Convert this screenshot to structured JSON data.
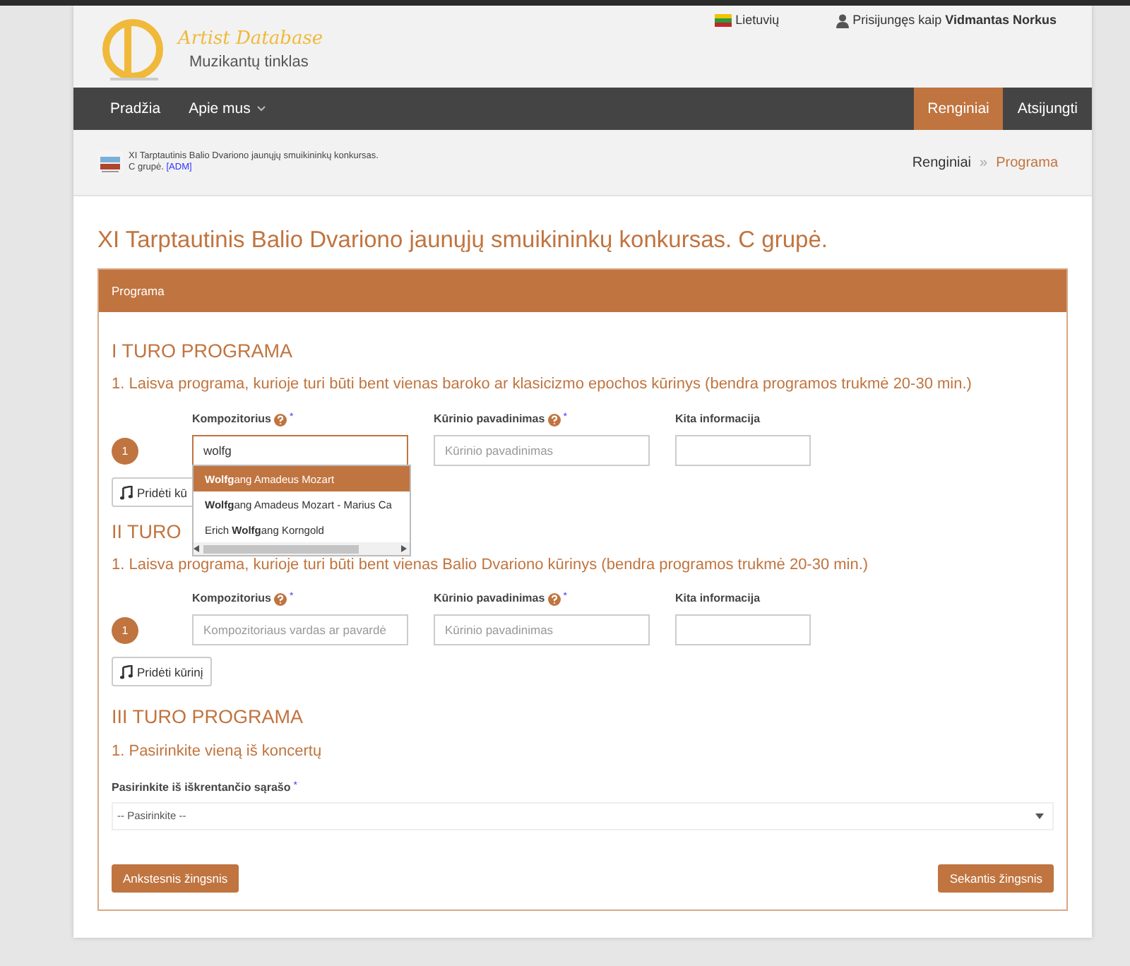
{
  "header": {
    "brand": "Artist Database",
    "tagline": "Muzikantų tinklas",
    "language": "Lietuvių",
    "user_prefix": "Prisijungęs kaip",
    "user_name": "Vidmantas Norkus"
  },
  "nav": {
    "left": [
      {
        "label": "Pradžia",
        "dropdown": false
      },
      {
        "label": "Apie mus",
        "dropdown": true
      }
    ],
    "right": [
      {
        "label": "Renginiai",
        "selected": true
      },
      {
        "label": "Atsijungti",
        "selected": false
      }
    ]
  },
  "breadcrumb_bar": {
    "event": "XI Tarptautinis Balio Dvariono jaunųjų smuikininkų konkursas. C grupė.",
    "admin_link": "[ADM]",
    "crumbs": [
      {
        "label": "Renginiai",
        "selected": false
      },
      {
        "label": "Programa",
        "selected": true
      }
    ],
    "separator": "»"
  },
  "title": "XI Tarptautinis Balio Dvariono jaunųjų smuikininkų konkursas. C grupė.",
  "panel": {
    "title": "Programa",
    "rounds": [
      {
        "heading": "I TURO PROGRAMA",
        "task": "1. Laisva programa, kurioje turi būti bent vienas baroko ar klasicizmo epochos kūrinys (bendra programos trukmė 20-30 min.)",
        "kind": "pieces",
        "labels": [
          "Kompozitorius",
          "Kūrinio pavadinimas",
          "Kita informacija"
        ],
        "required": [
          "*",
          "*"
        ],
        "rows": [
          {
            "number": "1",
            "composer": {
              "value": "wolfg"
            },
            "piece": {
              "placeholder": "Kūrinio pavadinimas"
            }
          }
        ],
        "add_button": "Pridėti kū",
        "suggestions": [
          {
            "text": "**Wolfg**ang Amadeus Mozart",
            "selected": true
          },
          {
            "text": "**Wolfg**ang Amadeus Mozart - Marius Ca",
            "selected": false
          },
          {
            "text": "Erich **Wolfg**ang Korngold",
            "selected": false
          }
        ]
      },
      {
        "heading": "II TURO",
        "task": "1. Laisva programa, kurioje turi būti bent vienas Balio Dvariono kūrinys (bendra programos trukmė 20-30 min.)",
        "kind": "pieces",
        "labels": [
          "Kompozitorius",
          "Kūrinio pavadinimas",
          "Kita informacija"
        ],
        "required": [
          "*",
          "*"
        ],
        "rows": [
          {
            "number": "1",
            "composer": {
              "placeholder": "Kompozitoriaus vardas ar pavardė"
            },
            "piece": {
              "placeholder": "Kūrinio pavadinimas"
            }
          }
        ],
        "add_button": "Pridėti kūrinį"
      },
      {
        "heading": "III TURO PROGRAMA",
        "task": "1. Pasirinkite vieną iš koncertų",
        "kind": "select",
        "select_label": "Pasirinkite iš iškrentančio sąrašo",
        "required": "*",
        "select_value": "-- Pasirinkite --"
      }
    ],
    "prev_button": "Ankstesnis žingsnis",
    "next_button": "Sekantis žingsnis"
  }
}
